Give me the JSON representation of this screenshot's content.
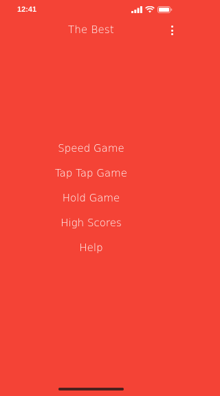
{
  "status_bar": {
    "time": "12:41",
    "icons": [
      "signal-icon",
      "wifi-icon",
      "battery-icon"
    ]
  },
  "app_bar": {
    "title": "The Best",
    "overflow_icon": "more-vertical-icon"
  },
  "menu": {
    "items": [
      {
        "label": "Speed Game"
      },
      {
        "label": "Tap Tap Game"
      },
      {
        "label": "Hold Game"
      },
      {
        "label": "High Scores"
      },
      {
        "label": "Help"
      }
    ]
  },
  "colors": {
    "background": "#F44336",
    "text": "#FFFFFF"
  }
}
